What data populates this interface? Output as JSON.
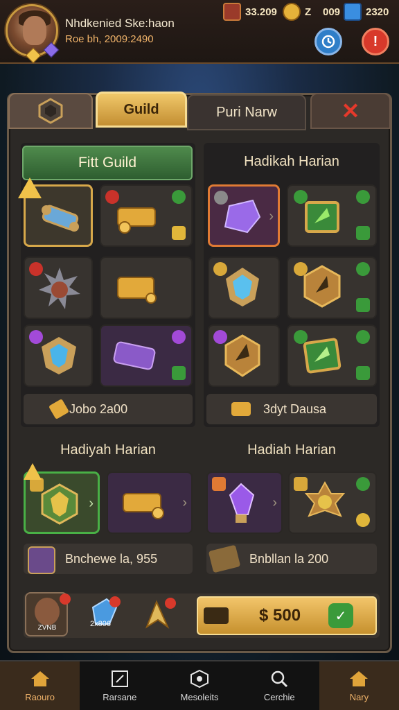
{
  "player": {
    "name": "Nhdkenied Ske:haon",
    "subtitle": "Roe bh, 2009:2490"
  },
  "resources": [
    {
      "icon": "ruby-icon",
      "value": "33.209"
    },
    {
      "icon": "gold-coin-icon",
      "value": "Z"
    },
    {
      "icon": "",
      "value": "009"
    },
    {
      "icon": "blue-gem-icon",
      "value": "2320"
    }
  ],
  "header_buttons": {
    "clock": "clock-icon",
    "close": "!"
  },
  "tabs": [
    {
      "label": ""
    },
    {
      "label": "Guild"
    },
    {
      "label": "Puri Narw"
    },
    {
      "label": "✕"
    }
  ],
  "sections": {
    "top_left_title": "Fitt Guild",
    "top_right_title": "Hadikah Harian",
    "mid_left_title": "Hadiyah Harian",
    "mid_right_title": "Hadiah Harian"
  },
  "bars": {
    "left_total": "Jobo 2a00",
    "right_total": "3dyt Dausa",
    "left_reward": "Bnchewe la, 955",
    "right_reward": "Bnbllan la 200"
  },
  "footer": {
    "tile_label": "ZVNB",
    "gem_count": "2x806",
    "price": "$ 500"
  },
  "nav": [
    {
      "label": "Raouro",
      "icon": "home-icon"
    },
    {
      "label": "Rarsane",
      "icon": "edit-icon"
    },
    {
      "label": "Mesoleits",
      "icon": "hex-icon"
    },
    {
      "label": "Cerchie",
      "icon": "search-icon"
    },
    {
      "label": "Nary",
      "icon": "home-icon"
    }
  ]
}
